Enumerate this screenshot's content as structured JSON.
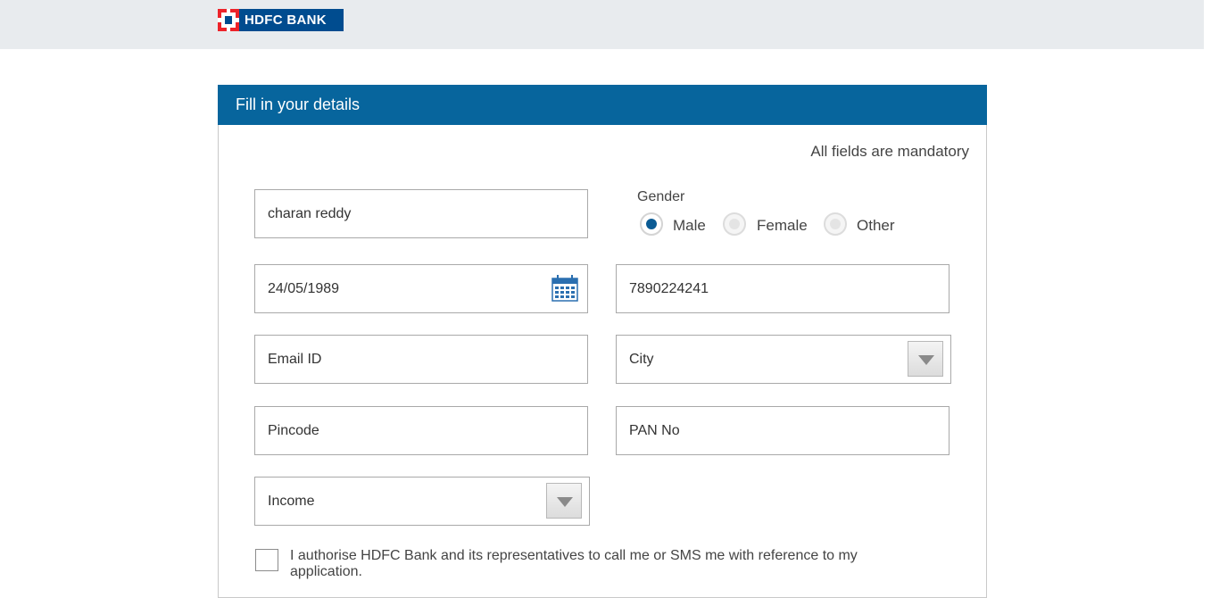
{
  "header": {
    "logo_text": "HDFC BANK"
  },
  "form": {
    "title": "Fill in your details",
    "mandatory_note": "All fields are mandatory",
    "name_value": "charan reddy",
    "gender": {
      "label": "Gender",
      "options": [
        "Male",
        "Female",
        "Other"
      ],
      "selected": "Male"
    },
    "dob_value": "24/05/1989",
    "mobile_value": "7890224241",
    "email_placeholder": "Email ID",
    "city_placeholder": "City",
    "pincode_placeholder": "Pincode",
    "pan_placeholder": "PAN No",
    "income_placeholder": "Income",
    "consent_text": "I authorise HDFC Bank and its representatives to call me or SMS me with reference to my application."
  },
  "icons": {
    "calendar": "calendar-icon",
    "dropdown": "triangle-down-icon"
  },
  "colors": {
    "brand_blue": "#004c8f",
    "header_blue": "#07659d",
    "brand_red": "#ed232a",
    "topbar_bg": "#e8ebee"
  }
}
